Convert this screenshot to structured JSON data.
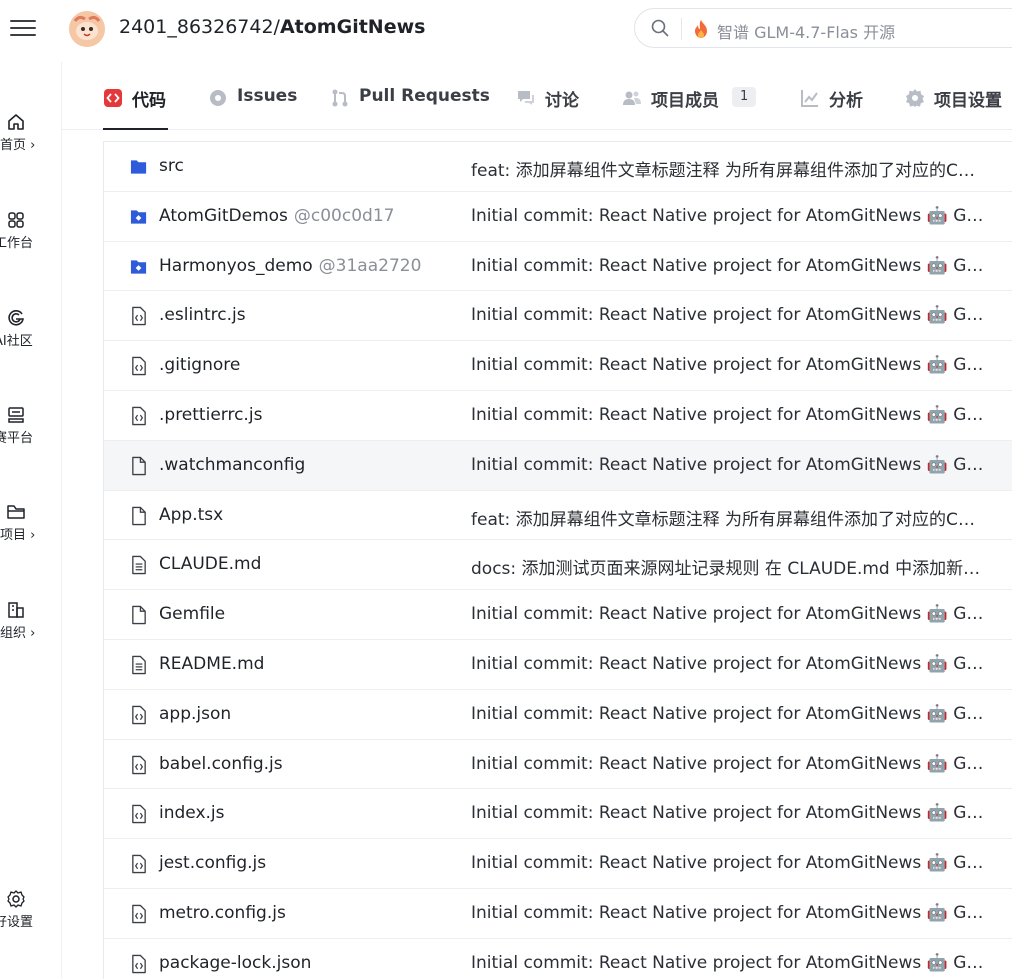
{
  "header": {
    "repo_owner": "2401_86326742/",
    "repo_name": "AtomGitNews",
    "search_placeholder": "智谱 GLM-4.7-Flas 开源"
  },
  "sidebar": {
    "items": [
      {
        "label": "首页 ›",
        "icon": "home-icon"
      },
      {
        "label": "工作台",
        "icon": "workbench-icon"
      },
      {
        "label": "AI社区",
        "icon": "ai-community-icon"
      },
      {
        "label": "赛平台",
        "icon": "competition-icon"
      },
      {
        "label": "项目 ›",
        "icon": "folder-icon"
      },
      {
        "label": "组织 ›",
        "icon": "organization-icon"
      },
      {
        "label": "好设置",
        "icon": "settings-icon"
      }
    ]
  },
  "tabs": [
    {
      "label": "代码",
      "icon": "code-icon",
      "active": true
    },
    {
      "label": "Issues",
      "icon": "issues-icon"
    },
    {
      "label": "Pull Requests",
      "icon": "pull-request-icon"
    },
    {
      "label": "讨论",
      "icon": "discussion-icon"
    },
    {
      "label": "项目成员",
      "icon": "members-icon",
      "badge": "1"
    },
    {
      "label": "分析",
      "icon": "analytics-icon"
    },
    {
      "label": "项目设置",
      "icon": "settings-icon"
    }
  ],
  "files": [
    {
      "name": "src",
      "type": "folder",
      "hash": "",
      "message": "feat: 添加屏幕组件文章标题注释 为所有屏幕组件添加了对应的CSDN文章标题注释"
    },
    {
      "name": "AtomGitDemos",
      "type": "submodule",
      "hash": "@c00c0d17",
      "message": "Initial commit: React Native project for AtomGitNews 🤖 Generated with Claude Code"
    },
    {
      "name": "Harmonyos_demo",
      "type": "submodule",
      "hash": "@31aa2720",
      "message": "Initial commit: React Native project for AtomGitNews 🤖 Generated with Claude Code"
    },
    {
      "name": ".eslintrc.js",
      "type": "code",
      "hash": "",
      "message": "Initial commit: React Native project for AtomGitNews 🤖 Generated with Claude Code"
    },
    {
      "name": ".gitignore",
      "type": "code",
      "hash": "",
      "message": "Initial commit: React Native project for AtomGitNews 🤖 Generated with Claude Code"
    },
    {
      "name": ".prettierrc.js",
      "type": "code",
      "hash": "",
      "message": "Initial commit: React Native project for AtomGitNews 🤖 Generated with Claude Code"
    },
    {
      "name": ".watchmanconfig",
      "type": "file",
      "hash": "",
      "message": "Initial commit: React Native project for AtomGitNews 🤖 Generated with Claude Code"
    },
    {
      "name": "App.tsx",
      "type": "file",
      "hash": "",
      "message": "feat: 添加屏幕组件文章标题注释 为所有屏幕组件添加了对应的CSDN文章标题注释"
    },
    {
      "name": "CLAUDE.md",
      "type": "doc",
      "hash": "",
      "message": "docs: 添加测试页面来源网址记录规则 在 CLAUDE.md 中添加新的规则说明"
    },
    {
      "name": "Gemfile",
      "type": "file",
      "hash": "",
      "message": "Initial commit: React Native project for AtomGitNews 🤖 Generated with Claude Code"
    },
    {
      "name": "README.md",
      "type": "doc",
      "hash": "",
      "message": "Initial commit: React Native project for AtomGitNews 🤖 Generated with Claude Code"
    },
    {
      "name": "app.json",
      "type": "code",
      "hash": "",
      "message": "Initial commit: React Native project for AtomGitNews 🤖 Generated with Claude Code"
    },
    {
      "name": "babel.config.js",
      "type": "code",
      "hash": "",
      "message": "Initial commit: React Native project for AtomGitNews 🤖 Generated with Claude Code"
    },
    {
      "name": "index.js",
      "type": "code",
      "hash": "",
      "message": "Initial commit: React Native project for AtomGitNews 🤖 Generated with Claude Code"
    },
    {
      "name": "jest.config.js",
      "type": "code",
      "hash": "",
      "message": "Initial commit: React Native project for AtomGitNews 🤖 Generated with Claude Code"
    },
    {
      "name": "metro.config.js",
      "type": "code",
      "hash": "",
      "message": "Initial commit: React Native project for AtomGitNews 🤖 Generated with Claude Code"
    },
    {
      "name": "package-lock.json",
      "type": "code",
      "hash": "",
      "message": "Initial commit: React Native project for AtomGitNews 🤖 Generated with Claude Code"
    }
  ],
  "colors": {
    "accent_red": "#e5383b",
    "folder_blue": "#2e5bd9",
    "text": "#1f2329",
    "muted": "#8a8f98"
  }
}
